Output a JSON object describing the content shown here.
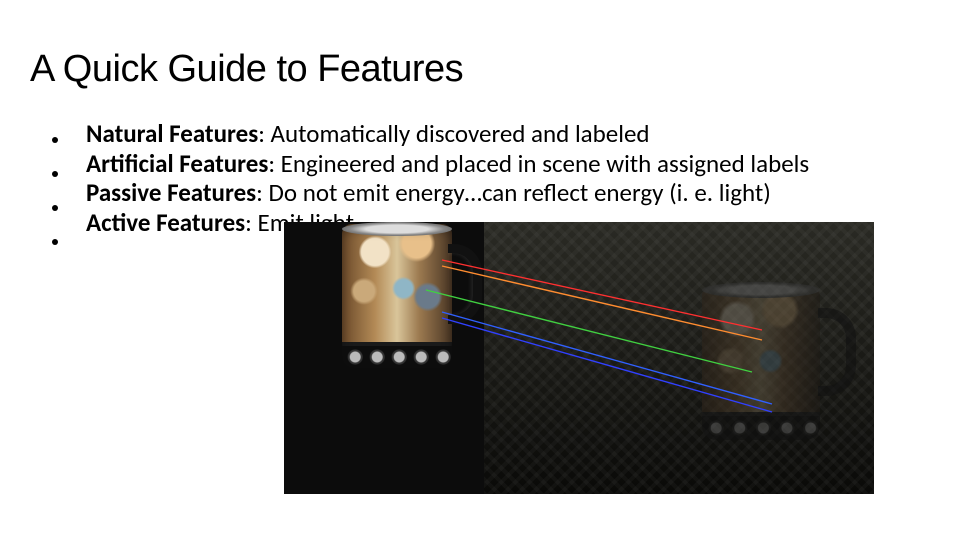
{
  "title": "A Quick Guide to Features",
  "items": [
    {
      "term": "Natural Features",
      "desc": ": Automatically discovered and labeled"
    },
    {
      "term": "Artificial Features",
      "desc": ": Engineered and placed in scene with assigned labels"
    },
    {
      "term": "Passive Features",
      "desc": ": Do not emit energy…can reflect energy (i. e. light)"
    },
    {
      "term": "Active Features",
      "desc": ": Emit light"
    }
  ]
}
